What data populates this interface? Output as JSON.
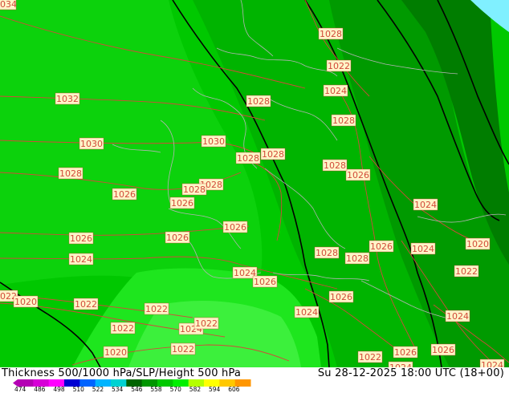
{
  "map": {
    "pressure_labels": [
      {
        "text": "1034"
      },
      {
        "text": "1032"
      },
      {
        "text": "1030"
      },
      {
        "text": "1028"
      },
      {
        "text": "1026"
      },
      {
        "text": "1026"
      },
      {
        "text": "1024"
      },
      {
        "text": "1026"
      },
      {
        "text": "1022"
      },
      {
        "text": "1020"
      },
      {
        "text": "1022"
      },
      {
        "text": "1022"
      },
      {
        "text": "1020"
      },
      {
        "text": "1022"
      },
      {
        "text": "1024"
      },
      {
        "text": "1022"
      },
      {
        "text": "1022"
      },
      {
        "text": "1030"
      },
      {
        "text": "1028"
      },
      {
        "text": "1028"
      },
      {
        "text": "1028"
      },
      {
        "text": "1026"
      },
      {
        "text": "1028"
      },
      {
        "text": "1024"
      },
      {
        "text": "1026"
      },
      {
        "text": "1024"
      },
      {
        "text": "1026"
      },
      {
        "text": "1024"
      },
      {
        "text": "1028"
      },
      {
        "text": "1026"
      },
      {
        "text": "1028"
      },
      {
        "text": "1022"
      },
      {
        "text": "1024"
      },
      {
        "text": "1028"
      },
      {
        "text": "1028"
      },
      {
        "text": "1026"
      },
      {
        "text": "1028"
      },
      {
        "text": "1028"
      },
      {
        "text": "1026"
      },
      {
        "text": "1024"
      },
      {
        "text": "1024"
      },
      {
        "text": "1020"
      },
      {
        "text": "1022"
      },
      {
        "text": "1024"
      },
      {
        "text": "1022"
      },
      {
        "text": "1026"
      },
      {
        "text": "1026"
      },
      {
        "text": "1024"
      },
      {
        "text": "1024"
      }
    ]
  },
  "footer": {
    "title": "Thickness 500/1000 hPa/SLP/Height 500 hPa",
    "valid_time": "Su 28-12-2025 18:00 UTC (18+00)"
  },
  "legend": {
    "ticks": [
      "474",
      "486",
      "498",
      "510",
      "522",
      "534",
      "546",
      "558",
      "570",
      "582",
      "594",
      "606"
    ],
    "colors": [
      "#b400b4",
      "#d700d7",
      "#ff00ff",
      "#0000d2",
      "#0064ff",
      "#00b4ff",
      "#00d2d2",
      "#006400",
      "#009600",
      "#00c800",
      "#00f000",
      "#b4ff00",
      "#ffff00",
      "#ffc800",
      "#ff9600"
    ]
  },
  "colors": {
    "thickness_bands": [
      "#00c800",
      "#00b400",
      "#00a000",
      "#009600",
      "#007d00",
      "#20e820"
    ],
    "sea_corner": "#80f0ff",
    "isobar": "#d24a3a",
    "height_contour": "#000000",
    "coastline": "#b4b4b4",
    "label_box": "#fff5c8"
  }
}
